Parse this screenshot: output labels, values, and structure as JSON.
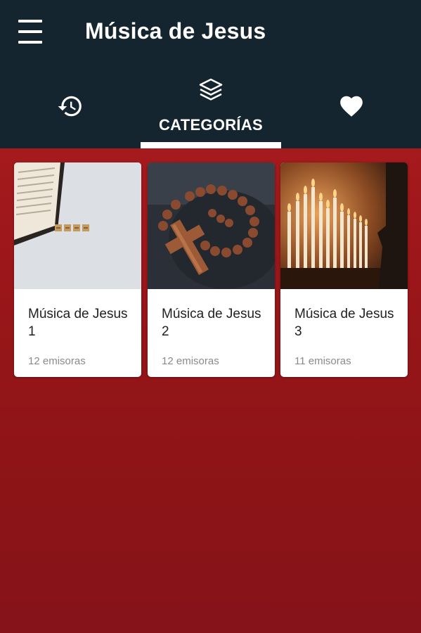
{
  "app": {
    "title": "Música de Jesus"
  },
  "tabs": [
    {
      "id": "recent",
      "icon": "history-icon",
      "label": ""
    },
    {
      "id": "categories",
      "icon": "layers-icon",
      "label": "CATEGORÍAS",
      "selected": true
    },
    {
      "id": "favorites",
      "icon": "heart-icon",
      "label": ""
    }
  ],
  "categories": [
    {
      "title": "Música de Jesus 1",
      "count": "12 emisoras",
      "image": "open-bible-with-word-tiles"
    },
    {
      "title": "Música de Jesus 2",
      "count": "12 emisoras",
      "image": "wooden-rosary-cross"
    },
    {
      "title": "Música de Jesus 3",
      "count": "11 emisoras",
      "image": "lit-church-candles"
    }
  ],
  "colors": {
    "header": "#15252f",
    "accent_red": "#a51a1d",
    "card": "#ffffff"
  }
}
